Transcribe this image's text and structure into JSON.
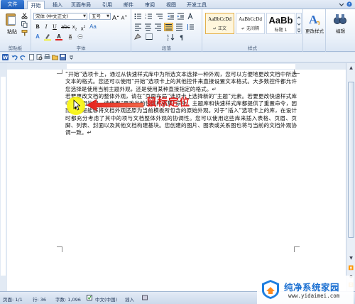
{
  "tabs": [
    {
      "label": "文件"
    },
    {
      "label": "开始"
    },
    {
      "label": "插入"
    },
    {
      "label": "页面布局"
    },
    {
      "label": "引用"
    },
    {
      "label": "邮件"
    },
    {
      "label": "审阅"
    },
    {
      "label": "视图"
    },
    {
      "label": "开发工具"
    }
  ],
  "ribbon": {
    "clipboard": {
      "paste_label": "粘贴",
      "group_label": "剪贴板"
    },
    "font": {
      "font_name": "宋体 (中文正文)",
      "font_size": "五号",
      "group_label": "字体"
    },
    "paragraph": {
      "group_label": "段落"
    },
    "styles": {
      "items": [
        {
          "sample": "AaBbCcDd",
          "name": "↵ 正文"
        },
        {
          "sample": "AaBbCcDd",
          "name": "↵ 无间隔"
        },
        {
          "sample": "AaBb",
          "name": "标题 1"
        }
      ],
      "change_styles_label": "更改样式",
      "group_label": "样式"
    },
    "editing": {
      "label": "编辑"
    }
  },
  "document": {
    "paragraphs": [
      "“开始”选项卡上，通过从快速样式库中为所选文本选择一种外观，您可以方便地更改文档中所选文本的格式。您还可以使用“开始”选项卡上的其他控件来直接设置文本格式。大多数控件都允许您选择是使用当前主题外观，还是使用某种直接指定的格式。↵",
      "若要更改文档的整体外观，请在“页面布局”选项卡上选择新的“主题”元素。若要更改快速样式库中的可用外观，请使用“更改当前快速样式集”命令。主题库和快速样式库都提供了重置命令，因而您总是能够将文档外观还原为当前模板所包含的原始外观。对于“插入”选项卡上的库，在设计时都充分考虑了其中的项与文档整体外观的协调性。您可以使用这些库来插入表格、页眉、页脚、列表、封面以及其他文档构建基块。您创建的图片、图表或关系图也将与当前的文档外观协调一致。↵"
    ],
    "annotation_label": "鼠标定位"
  },
  "statusbar": {
    "page": "页面: 1/1",
    "line": "行: 36",
    "words": "字数: 1,096",
    "language": "中文(中国)",
    "mode": "插入"
  },
  "watermark": {
    "title": "纯净系统家园",
    "url": "www.yidaimei.com"
  },
  "colors": {
    "accent": "#1e5db8",
    "annotation": "#e0201d",
    "highlight": "#f7f31a"
  }
}
